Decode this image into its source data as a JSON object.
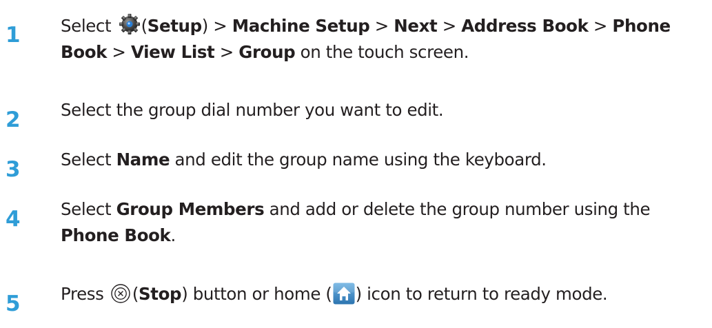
{
  "steps": [
    {
      "number": "1",
      "line1": {
        "t0": "Select ",
        "t1": "(",
        "b1": "Setup",
        "t2": ") > ",
        "b2": "Machine Setup",
        "t3": " > ",
        "b3": "Next",
        "t4": " > ",
        "b4": "Address Book",
        "t5": " > ",
        "b5": "Phone"
      },
      "line2": {
        "b1": "Book",
        "t1": " > ",
        "b2": "View List",
        "t2": " > ",
        "b3": "Group",
        "t3": " on the touch screen."
      }
    },
    {
      "number": "2",
      "line1": {
        "t0": "Select the group dial number you want to edit."
      }
    },
    {
      "number": "3",
      "line1": {
        "t0": "Select ",
        "b1": "Name",
        "t1": " and edit the group name using the keyboard."
      }
    },
    {
      "number": "4",
      "line1": {
        "t0": "Select ",
        "b1": "Group Members",
        "t1": " and add or delete the group number using the"
      },
      "line2": {
        "b1": "Phone Book",
        "t1": "."
      }
    },
    {
      "number": "5",
      "line1": {
        "t0": "Press ",
        "t1": "(",
        "b1": "Stop",
        "t2": ") button or home (",
        "t3": ") icon to return to ready mode."
      }
    }
  ],
  "icons": {
    "setup": "gear-icon",
    "stop": "stop-icon",
    "home": "home-icon"
  },
  "colors": {
    "step_number": "#2f9dd7",
    "text": "#231f20",
    "home_button": "#3d8fc4"
  }
}
